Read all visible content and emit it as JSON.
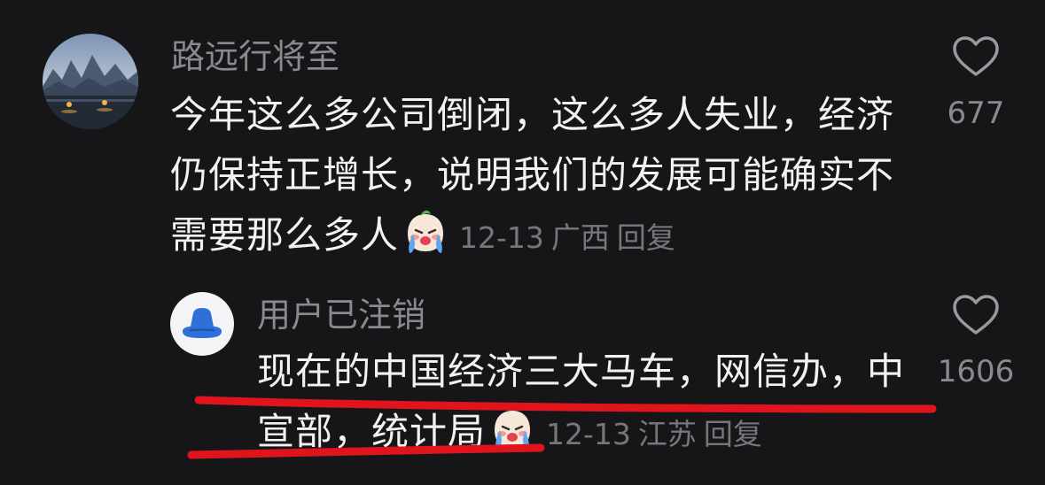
{
  "comments": [
    {
      "username": "路远行将至",
      "text": "今年这么多公司倒闭，这么多人失业，经济仍保持正增长，说明我们的发展可能确实不需要那么多人",
      "emoji": "crying-face-emoji",
      "date": "12-13",
      "location": "广西",
      "reply_label": "回复",
      "likes": "677"
    },
    {
      "username": "用户已注销",
      "text": "现在的中国经济三大马车，网信办，中宣部，统计局",
      "emoji": "crying-face-emoji",
      "date": "12-13",
      "location": "江苏",
      "reply_label": "回复",
      "likes": "1606"
    }
  ],
  "colors": {
    "background": "#161618",
    "text": "#f2f2f2",
    "muted": "#8a8a8e",
    "underline": "#e0141c",
    "avatar_blue": "#2f6fd8"
  }
}
